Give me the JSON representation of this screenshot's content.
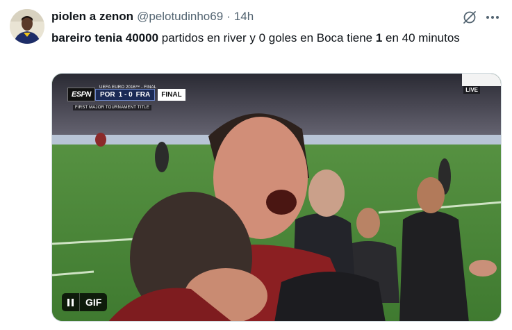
{
  "tweet": {
    "display_name": "piolen a zenon",
    "handle": "@pelotudinho69",
    "separator": "·",
    "time": "14h",
    "text_bold_1": "bareiro tenia 40000",
    "text_1": " partidos en river y 0 goles en Boca tiene ",
    "text_bold_2": "1",
    "text_2": " en 40 minutos"
  },
  "media": {
    "gif_label": "GIF",
    "pause_label": "pause",
    "scoreboard": {
      "network": "ESPN",
      "tournament": "UEFA EURO 2016™ - FINAL",
      "home": "POR",
      "score": "1 - 0",
      "away": "FRA",
      "status": "FINAL",
      "subtitle": "FIRST MAJOR TOURNAMENT TITLE",
      "live": "LIVE"
    }
  },
  "icons": {
    "grok": "grok-icon",
    "more": "more-icon"
  },
  "colors": {
    "secondary_text": "#536471",
    "primary_text": "#0f1419",
    "border": "#cfd9de"
  }
}
